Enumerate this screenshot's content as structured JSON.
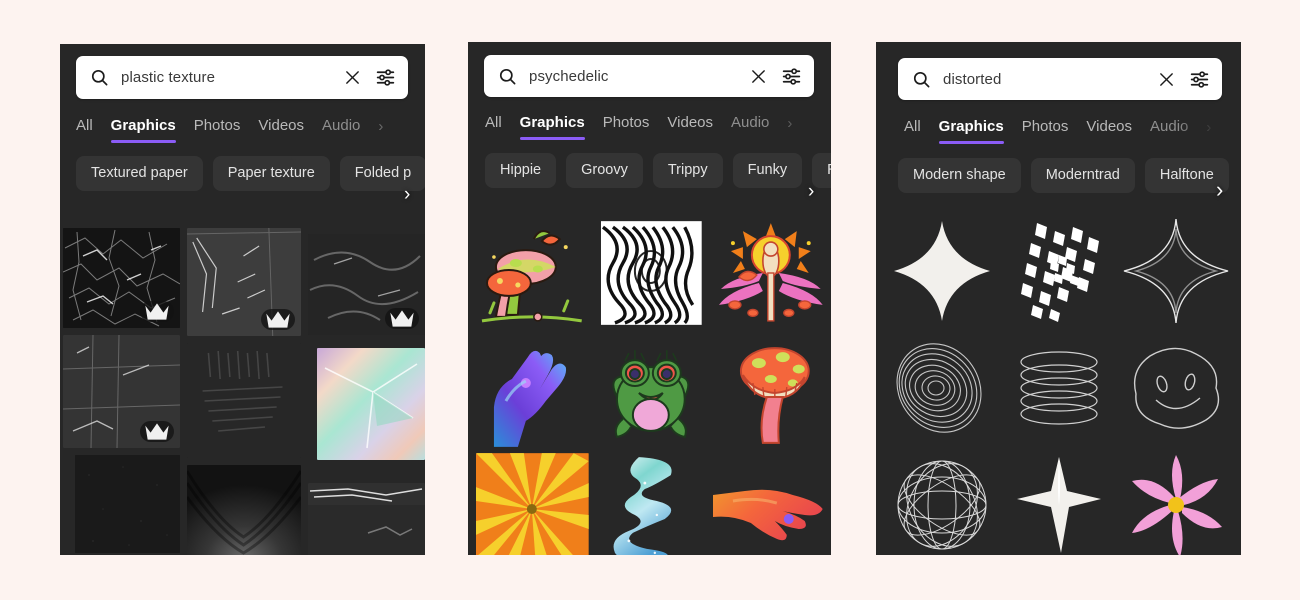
{
  "page": {
    "background_color": "#fdf3f0",
    "panel_background": "#272727",
    "accent_color": "#8b5cf6",
    "searchbar_background": "#ffffff",
    "chip_background": "#343434"
  },
  "panels": [
    {
      "id": "panel-plastic-texture",
      "search": {
        "value": "plastic texture",
        "placeholder": "Search",
        "search_icon": "search-icon",
        "clear_icon": "close-icon",
        "filter_icon": "sliders-icon"
      },
      "tabs": [
        {
          "label": "All",
          "active": false,
          "faded": false
        },
        {
          "label": "Graphics",
          "active": true,
          "faded": false
        },
        {
          "label": "Photos",
          "active": false,
          "faded": false
        },
        {
          "label": "Videos",
          "active": false,
          "faded": false
        },
        {
          "label": "Audio",
          "active": false,
          "faded": true
        }
      ],
      "tabs_next_icon": "chevron-right-icon",
      "chips": [
        "Textured paper",
        "Paper texture",
        "Folded p"
      ],
      "chips_next_icon": "chevron-right-icon",
      "results": [
        {
          "name": "crinkled-black-plastic",
          "premium": true
        },
        {
          "name": "clear-plastic-sheet",
          "premium": true
        },
        {
          "name": "dark-plastic-wrap",
          "premium": true
        },
        {
          "name": "grey-plastic-film",
          "premium": true
        },
        {
          "name": "textured-ribbed-plastic",
          "premium": false
        },
        {
          "name": "holographic-iridescent-foil",
          "premium": false
        },
        {
          "name": "black-speckled-surface",
          "premium": false
        },
        {
          "name": "draped-black-fabric",
          "premium": false
        },
        {
          "name": "reflective-plastic-strip",
          "premium": false
        }
      ]
    },
    {
      "id": "panel-psychedelic",
      "search": {
        "value": "psychedelic",
        "placeholder": "Search",
        "search_icon": "search-icon",
        "clear_icon": "close-icon",
        "filter_icon": "sliders-icon"
      },
      "tabs": [
        {
          "label": "All",
          "active": false,
          "faded": false
        },
        {
          "label": "Graphics",
          "active": true,
          "faded": false
        },
        {
          "label": "Photos",
          "active": false,
          "faded": false
        },
        {
          "label": "Videos",
          "active": false,
          "faded": false
        },
        {
          "label": "Audio",
          "active": false,
          "faded": true
        }
      ],
      "tabs_next_icon": "chevron-right-icon",
      "chips": [
        "Hippie",
        "Groovy",
        "Trippy",
        "Funky",
        "Ret"
      ],
      "chips_next_icon": "chevron-right-icon",
      "results": [
        {
          "name": "mushroom-cluster-illustration",
          "premium": false
        },
        {
          "name": "optical-illusion-wave-pattern",
          "premium": false
        },
        {
          "name": "sun-goddess-mushroom-scene",
          "premium": false
        },
        {
          "name": "gradient-reaching-hand",
          "premium": false
        },
        {
          "name": "psychedelic-frog-character",
          "premium": false
        },
        {
          "name": "spotted-red-mushroom",
          "premium": false
        },
        {
          "name": "sunburst-rays-orange-yellow",
          "premium": false
        },
        {
          "name": "liquid-blob-gradient-path",
          "premium": false
        },
        {
          "name": "gradient-pointing-hand",
          "premium": false
        }
      ]
    },
    {
      "id": "panel-distorted",
      "search": {
        "value": "distorted",
        "placeholder": "Search",
        "search_icon": "search-icon",
        "clear_icon": "close-icon",
        "filter_icon": "sliders-icon"
      },
      "tabs": [
        {
          "label": "All",
          "active": false,
          "faded": false
        },
        {
          "label": "Graphics",
          "active": true,
          "faded": false
        },
        {
          "label": "Photos",
          "active": false,
          "faded": false
        },
        {
          "label": "Videos",
          "active": false,
          "faded": false
        },
        {
          "label": "Audio",
          "active": false,
          "faded": true
        }
      ],
      "tabs_next_icon": "chevron-right-icon",
      "chips": [
        "Modern shape",
        "Moderntrad",
        "Halftone"
      ],
      "chips_next_icon": "chevron-right-icon",
      "results": [
        {
          "name": "four-point-star-solid",
          "premium": false
        },
        {
          "name": "distorted-checkerboard-wave",
          "premium": false
        },
        {
          "name": "four-point-star-outline",
          "premium": false
        },
        {
          "name": "concentric-ripple-contours",
          "premium": false
        },
        {
          "name": "stacked-ellipse-rings",
          "premium": false
        },
        {
          "name": "melted-smiley-face-outline",
          "premium": false
        },
        {
          "name": "wireframe-globe-sphere",
          "premium": false
        },
        {
          "name": "eight-point-sparkle-star",
          "premium": false
        },
        {
          "name": "pink-daisy-flower",
          "premium": false
        }
      ]
    }
  ]
}
